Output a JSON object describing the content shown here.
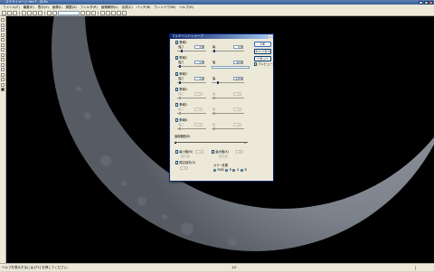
{
  "app": {
    "title": "ステライメージ Ver.7 - 月.fts"
  },
  "menubar": {
    "items": [
      "ファイル(F)",
      "編集(E)",
      "表示(V)",
      "画像(I)",
      "調整(A)",
      "フィルタ(R)",
      "画像解析(L)",
      "合成(C)",
      "バッチ(B)",
      "ウィンドウ(W)",
      "ヘルプ(H)"
    ]
  },
  "dialog": {
    "title": "マルチバンドシャープ",
    "ok": "OK",
    "cancel": "キャンセル",
    "reset": "リセット",
    "preview_label": "プレビュー(P)",
    "bands": [
      {
        "label": "帯域1",
        "checked": true,
        "strength_label": "強さ",
        "strength": "3",
        "width_label": "幅",
        "width": "2"
      },
      {
        "label": "帯域2",
        "checked": true,
        "strength_label": "強さ",
        "strength": "1",
        "width_label": "幅",
        "width": "10"
      },
      {
        "label": "帯域3",
        "checked": true,
        "strength_label": "強さ",
        "strength": "1",
        "width_label": "幅",
        "width": "1.8"
      },
      {
        "label": "帯域4",
        "checked": false,
        "strength_label": "強さ",
        "strength": "1",
        "width_label": "幅",
        "width": "1"
      },
      {
        "label": "帯域5",
        "checked": false,
        "strength_label": "強さ",
        "strength": "1",
        "width_label": "幅",
        "width": "1"
      },
      {
        "label": "帯域6",
        "checked": false,
        "strength_label": "強さ",
        "strength": "1",
        "width_label": "幅",
        "width": "1"
      }
    ],
    "range_label": "適用範囲(R)",
    "range_left": "",
    "range_right": "",
    "opt1": "最小値(N)",
    "opt1_value": "1",
    "opt2": "最大値(X)",
    "opt2_value": "10",
    "opt3": "周辺減光(V)",
    "opt3_value": "5",
    "color_label": "カラー処理",
    "radio_labels": [
      "RGB",
      "R",
      "G",
      "B"
    ],
    "radio_selected": 0
  },
  "status": {
    "left": "ヘルプを表示するには [F1] を押してください。",
    "center": "1/2"
  }
}
